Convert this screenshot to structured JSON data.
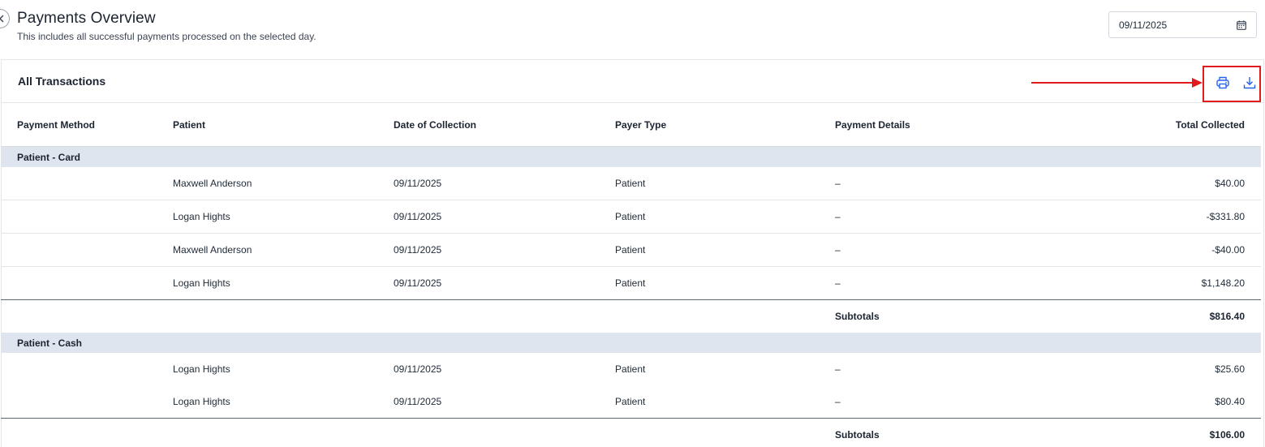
{
  "header": {
    "title": "Payments Overview",
    "subtitle": "This includes all successful payments processed on the selected day.",
    "date_value": "09/11/2025"
  },
  "panel": {
    "title": "All Transactions"
  },
  "icons": {
    "back": "chevron-left-icon",
    "calendar": "calendar-icon",
    "print": "printer-icon",
    "download": "download-icon"
  },
  "colors": {
    "accent": "#2563eb",
    "group_bg": "#dfe5ee",
    "annotation": "#e01b1b"
  },
  "table": {
    "columns": [
      "Payment Method",
      "Patient",
      "Date of Collection",
      "Payer Type",
      "Payment Details",
      "Total Collected"
    ],
    "groups": [
      {
        "name": "Patient - Card",
        "rows": [
          {
            "patient": "Maxwell Anderson",
            "date": "09/11/2025",
            "payer": "Patient",
            "details": "–",
            "total": "$40.00"
          },
          {
            "patient": "Logan Hights",
            "date": "09/11/2025",
            "payer": "Patient",
            "details": "–",
            "total": "-$331.80"
          },
          {
            "patient": "Maxwell Anderson",
            "date": "09/11/2025",
            "payer": "Patient",
            "details": "–",
            "total": "-$40.00"
          },
          {
            "patient": "Logan Hights",
            "date": "09/11/2025",
            "payer": "Patient",
            "details": "–",
            "total": "$1,148.20"
          }
        ],
        "subtotal_label": "Subtotals",
        "subtotal": "$816.40"
      },
      {
        "name": "Patient - Cash",
        "rows": [
          {
            "patient": "Logan Hights",
            "date": "09/11/2025",
            "payer": "Patient",
            "details": "–",
            "total": "$25.60"
          },
          {
            "patient": "Logan Hights",
            "date": "09/11/2025",
            "payer": "Patient",
            "details": "–",
            "total": "$80.40"
          }
        ],
        "subtotal_label": "Subtotals",
        "subtotal": "$106.00"
      }
    ]
  }
}
